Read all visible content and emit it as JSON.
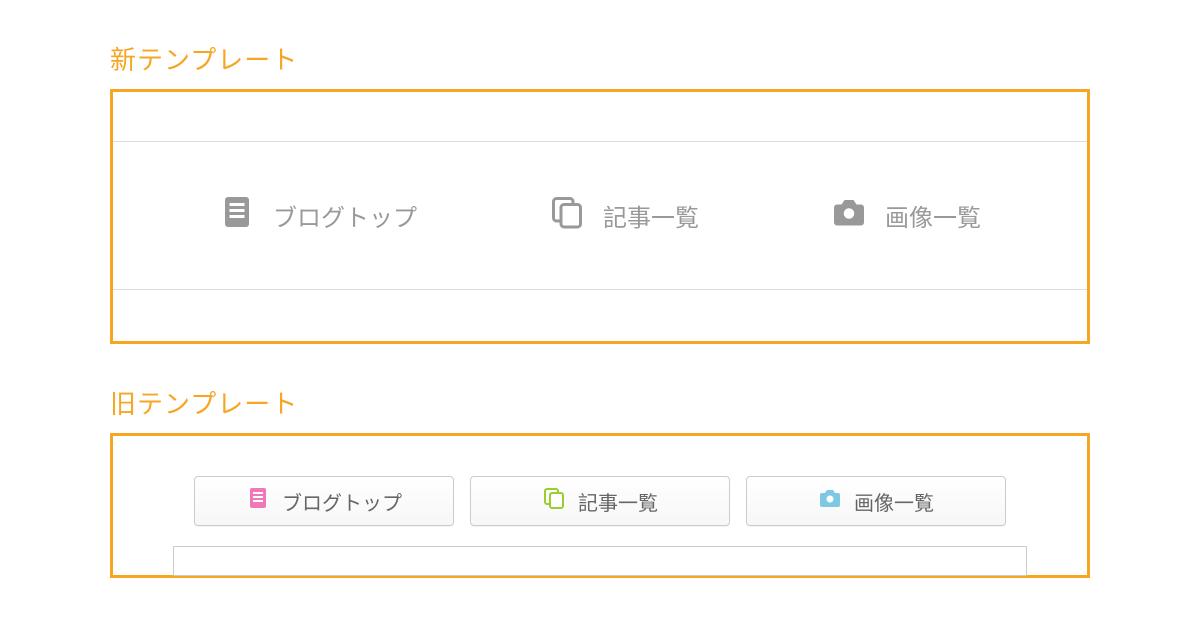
{
  "sections": {
    "new": {
      "title": "新テンプレート",
      "nav": [
        {
          "label": "ブログトップ",
          "icon": "document-icon"
        },
        {
          "label": "記事一覧",
          "icon": "copy-icon"
        },
        {
          "label": "画像一覧",
          "icon": "camera-icon"
        }
      ]
    },
    "old": {
      "title": "旧テンプレート",
      "buttons": [
        {
          "label": "ブログトップ",
          "icon": "document-icon"
        },
        {
          "label": "記事一覧",
          "icon": "copy-icon"
        },
        {
          "label": "画像一覧",
          "icon": "camera-icon"
        }
      ]
    }
  },
  "colors": {
    "accent": "#f5a623",
    "iconGray": "#999999",
    "iconPink": "#f078b8",
    "iconGreen": "#9acd32",
    "iconBlue": "#7ec8e3"
  }
}
